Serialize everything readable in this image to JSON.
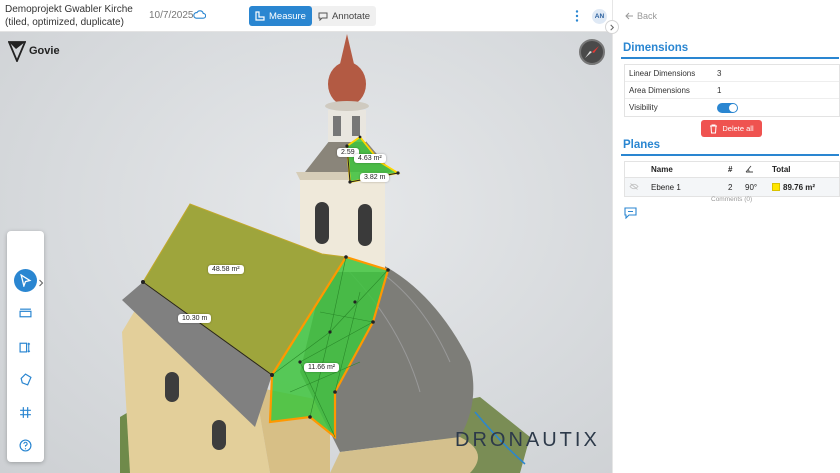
{
  "header": {
    "project_title": "Demoprojekt Gwabler Kirche (tiled, optimized, duplicate)",
    "date": "10/7/2025",
    "modes": [
      {
        "label": "Measure",
        "active": true
      },
      {
        "label": "Annotate",
        "active": false
      }
    ],
    "avatar_initials": "AN"
  },
  "viewport": {
    "logo_text": "Govie",
    "watermark": "DRONAUTIX",
    "labels": {
      "top_small": "2.59",
      "tower_area": "4.63 m²",
      "tower_length": "3.82 m",
      "roof_area": "48.58 m²",
      "roof_length": "10.30 m",
      "green_area": "11.66 m²"
    },
    "tools": [
      {
        "name": "select-tool",
        "active": true
      },
      {
        "name": "measure-line-tool",
        "active": false
      },
      {
        "name": "measure-object-tool",
        "active": false
      },
      {
        "name": "polygon-tool",
        "active": false
      },
      {
        "name": "grid-tool",
        "active": false
      },
      {
        "name": "help-tool",
        "active": false
      }
    ]
  },
  "panel": {
    "back_label": "Back",
    "dimensions": {
      "title": "Dimensions",
      "rows": [
        {
          "key": "Linear Dimensions",
          "value": "3"
        },
        {
          "key": "Area Dimensions",
          "value": "1"
        },
        {
          "key": "Visibility",
          "value": ""
        }
      ],
      "visibility_on": true,
      "delete_label": "Delete all"
    },
    "planes": {
      "title": "Planes",
      "headers": {
        "name": "Name",
        "count": "#",
        "total": "Total"
      },
      "rows": [
        {
          "name": "Ebene 1",
          "count": "2",
          "angle": "90°",
          "total": "89.76 m²"
        }
      ],
      "comments": "Comments (0)"
    }
  },
  "colors": {
    "accent": "#2a86d1",
    "danger": "#ef5350",
    "plane_swatch": "#ffe600"
  }
}
